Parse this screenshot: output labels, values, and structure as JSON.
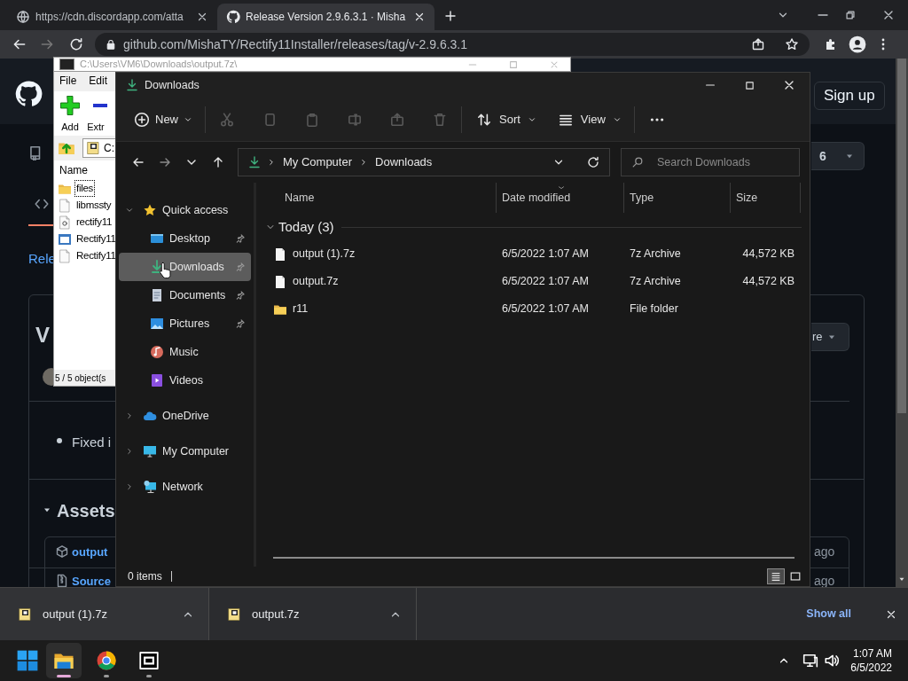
{
  "browser": {
    "tabs": [
      {
        "title": "https://cdn.discordapp.com/atta",
        "selected": false
      },
      {
        "title": "Release Version 2.9.6.3.1 · Misha",
        "selected": true
      }
    ],
    "url": "github.com/MishaTY/Rectify11Installer/releases/tag/v-2.9.6.3.1",
    "page": {
      "sign_up": "Sign up",
      "count": "6",
      "tab_link": "Rele",
      "release_title": "V",
      "note": "Fixed i",
      "menu_button": "re",
      "assets_heading": "Assets",
      "assets": [
        {
          "name": "output",
          "age": "ago"
        },
        {
          "name": "Source",
          "age": "ago"
        }
      ]
    }
  },
  "archive_window": {
    "title": "C:\\Users\\VM6\\Downloads\\output.7z\\",
    "menu": [
      "File",
      "Edit"
    ],
    "toolbar": [
      "Add",
      "Extr"
    ],
    "path": "C:",
    "column": "Name",
    "items": [
      {
        "name": "files",
        "kind": "folder",
        "selected": true
      },
      {
        "name": "libmssty",
        "kind": "file",
        "selected": false
      },
      {
        "name": "rectify11",
        "kind": "settings",
        "selected": false
      },
      {
        "name": "Rectify11",
        "kind": "program",
        "selected": false
      },
      {
        "name": "Rectify11",
        "kind": "file",
        "selected": false
      }
    ],
    "status": "5 / 5 object(s"
  },
  "explorer": {
    "title": "Downloads",
    "new": "New",
    "actions": [
      {
        "disabled": true
      },
      {
        "disabled": true
      },
      {
        "disabled": true
      },
      {
        "disabled": true
      },
      {
        "disabled": true
      },
      {
        "disabled": true
      }
    ],
    "sort": "Sort",
    "view": "View",
    "breadcrumb": [
      "My Computer",
      "Downloads"
    ],
    "search": {
      "placeholder": "Search Downloads"
    },
    "sidebar": [
      {
        "label": "Quick access",
        "expanded": true,
        "selected": false,
        "children": [
          {
            "label": "Desktop",
            "pinned": true,
            "selected": false
          },
          {
            "label": "Downloads",
            "pinned": true,
            "selected": true
          },
          {
            "label": "Documents",
            "pinned": true,
            "selected": false
          },
          {
            "label": "Pictures",
            "pinned": true,
            "selected": false
          },
          {
            "label": "Music",
            "pinned": false,
            "selected": false
          },
          {
            "label": "Videos",
            "pinned": false,
            "selected": false
          }
        ]
      },
      {
        "label": "OneDrive",
        "expanded": false,
        "selected": false
      },
      {
        "label": "My Computer",
        "expanded": false,
        "selected": false
      },
      {
        "label": "Network",
        "expanded": false,
        "selected": false
      }
    ],
    "columns": [
      {
        "label": "Name",
        "sorted": false
      },
      {
        "label": "Date modified",
        "sorted": true
      },
      {
        "label": "Type",
        "sorted": false
      },
      {
        "label": "Size",
        "sorted": false
      }
    ],
    "group": {
      "label": "Today (3)",
      "expanded": true
    },
    "files": [
      {
        "name": "output (1).7z",
        "kind": "file",
        "date": "6/5/2022 1:07 AM",
        "type": "7z Archive",
        "size": "44,572 KB"
      },
      {
        "name": "output.7z",
        "kind": "file",
        "date": "6/5/2022 1:07 AM",
        "type": "7z Archive",
        "size": "44,572 KB"
      },
      {
        "name": "r11",
        "kind": "folder",
        "date": "6/5/2022 1:07 AM",
        "type": "File folder"
      }
    ],
    "status": "0 items",
    "views": [
      {
        "selected": true
      },
      {
        "selected": false
      }
    ]
  },
  "downloads_bar": {
    "items": [
      {
        "name": "output (1).7z"
      },
      {
        "name": "output.7z"
      }
    ],
    "show_all": "Show all"
  },
  "taskbar": {
    "apps": [
      {
        "active": true
      },
      {
        "active": false
      },
      {
        "active": false
      }
    ],
    "time": "1:07 AM",
    "date": "6/5/2022"
  }
}
